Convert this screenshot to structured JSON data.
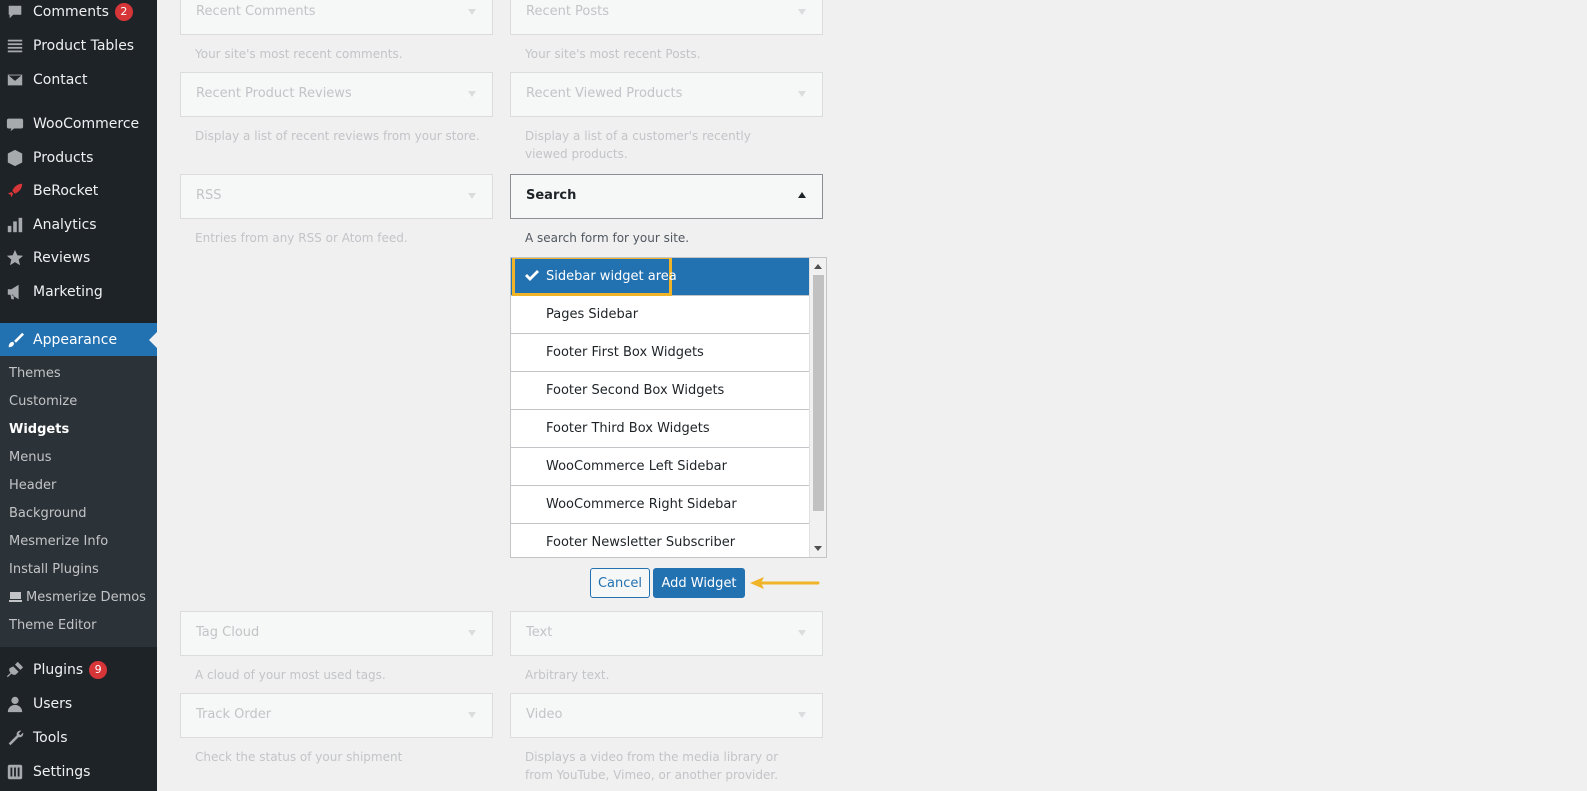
{
  "sidebar": {
    "items": [
      {
        "label": "Comments",
        "icon": "comment-icon",
        "badge": "2"
      },
      {
        "label": "Product Tables",
        "icon": "list-icon"
      },
      {
        "label": "Contact",
        "icon": "mail-icon"
      },
      {
        "label": "WooCommerce",
        "icon": "woocommerce-icon"
      },
      {
        "label": "Products",
        "icon": "box-icon"
      },
      {
        "label": "BeRocket",
        "icon": "rocket-icon"
      },
      {
        "label": "Analytics",
        "icon": "bar-chart-icon"
      },
      {
        "label": "Reviews",
        "icon": "star-icon"
      },
      {
        "label": "Marketing",
        "icon": "megaphone-icon"
      },
      {
        "label": "Appearance",
        "icon": "paintbrush-icon"
      },
      {
        "label": "Plugins",
        "icon": "plug-icon",
        "badge": "9"
      },
      {
        "label": "Users",
        "icon": "user-icon"
      },
      {
        "label": "Tools",
        "icon": "wrench-icon"
      },
      {
        "label": "Settings",
        "icon": "settings-icon"
      }
    ],
    "submenu": [
      "Themes",
      "Customize",
      "Widgets",
      "Menus",
      "Header",
      "Background",
      "Mesmerize Info",
      "Install Plugins",
      "Mesmerize Demos",
      "Theme Editor"
    ],
    "accent": "#2271b1"
  },
  "widgets": [
    {
      "title": "Recent Comments",
      "desc": "Your site's most recent comments."
    },
    {
      "title": "Recent Posts",
      "desc": "Your site's most recent Posts."
    },
    {
      "title": "Recent Product Reviews",
      "desc": "Display a list of recent reviews from your store."
    },
    {
      "title": "Recent Viewed Products",
      "desc": "Display a list of a customer's recently viewed products."
    },
    {
      "title": "RSS",
      "desc": "Entries from any RSS or Atom feed."
    },
    {
      "title": "Search",
      "desc": "A search form for your site."
    },
    {
      "title": "Tag Cloud",
      "desc": "A cloud of your most used tags."
    },
    {
      "title": "Text",
      "desc": "Arbitrary text."
    },
    {
      "title": "Track Order",
      "desc": "Check the status of your shipment"
    },
    {
      "title": "Video",
      "desc": "Displays a video from the media library or from YouTube, Vimeo, or another provider."
    }
  ],
  "chooser": {
    "items": [
      "Sidebar widget area",
      "Pages Sidebar",
      "Footer First Box Widgets",
      "Footer Second Box Widgets",
      "Footer Third Box Widgets",
      "WooCommerce Left Sidebar",
      "WooCommerce Right Sidebar",
      "Footer Newsletter Subscriber"
    ],
    "selected": "Sidebar widget area"
  },
  "buttons": {
    "cancel": "Cancel",
    "add": "Add Widget"
  },
  "highlight_color": "#f0b429"
}
